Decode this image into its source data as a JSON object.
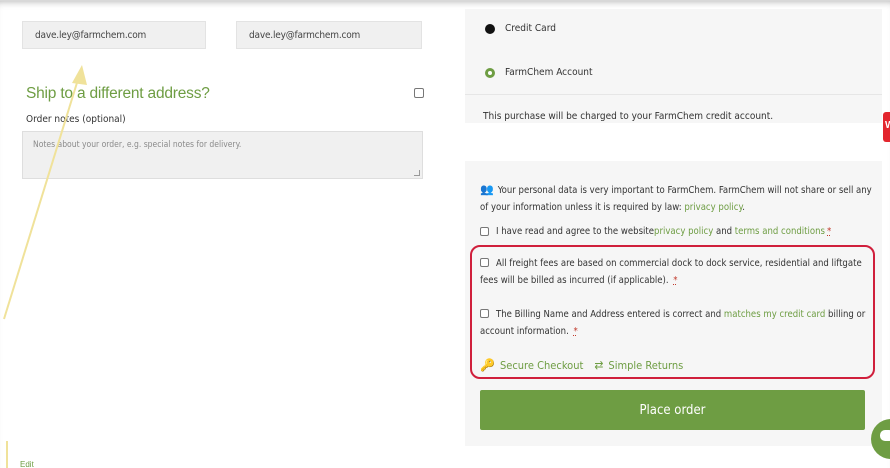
{
  "billing": {
    "email_value": "dave.ley@farmchem.com",
    "email_confirm_value": "dave.ley@farmchem.com"
  },
  "shipping": {
    "title": "Ship to a different address?",
    "notes_label": "Order notes (optional)",
    "notes_placeholder": "Notes about your order, e.g. special notes for delivery."
  },
  "footer": {
    "edit_link": "Edit"
  },
  "payment": {
    "options": [
      {
        "label": "Credit Card",
        "selected": false
      },
      {
        "label": "FarmChem Account",
        "selected": true
      }
    ],
    "description": "This purchase will be charged to your FarmChem credit account."
  },
  "privacy": {
    "text_before": "Your personal data is very important to FarmChem. FarmChem will not share or sell any of your information unless it is required by law: ",
    "policy_link": "privacy policy",
    "text_after": "."
  },
  "terms": {
    "prefix": "I have read and agree to the website ",
    "privacy_link": "privacy policy",
    "and": " and ",
    "terms_link": "terms and conditions",
    "required_mark": "*"
  },
  "freight": {
    "text": "All freight fees are based on commercial dock to dock service, residential and liftgate fees will be billed as incurred (if applicable).",
    "required_mark": "*"
  },
  "billing_confirm": {
    "prefix": "The Billing Name and Address entered is correct and ",
    "link": "matches my credit card",
    "suffix": " billing or account information.",
    "required_mark": "*"
  },
  "badges": {
    "secure": "Secure Checkout",
    "returns": "Simple Returns"
  },
  "actions": {
    "place_order": "Place order"
  },
  "colors": {
    "accent_green": "#6e9d43",
    "highlight_red": "#d01f3c",
    "annotation_yellow": "#f0e29a"
  }
}
